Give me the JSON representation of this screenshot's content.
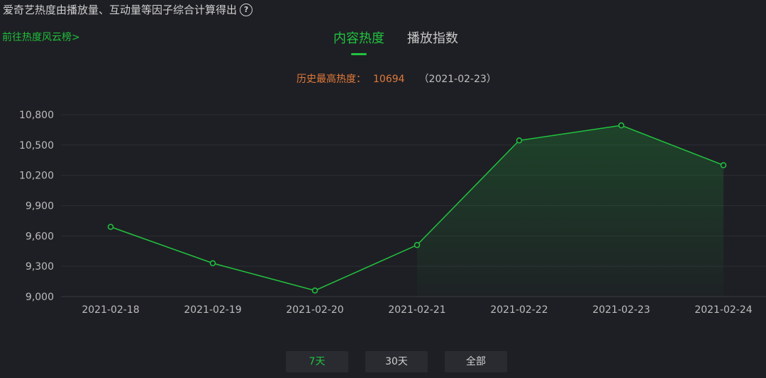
{
  "header": {
    "description": "爱奇艺热度由播放量、互动量等因子综合计算得出",
    "help_icon": "question-circle-icon"
  },
  "rank_link": "前往热度风云榜>",
  "tabs": [
    {
      "label": "内容热度",
      "active": true
    },
    {
      "label": "播放指数",
      "active": false
    }
  ],
  "peak": {
    "label": "历史最高热度：",
    "value": "10694",
    "date": "（2021-02-23）"
  },
  "range_buttons": [
    {
      "label": "7天",
      "active": true
    },
    {
      "label": "30天",
      "active": false
    },
    {
      "label": "全部",
      "active": false
    }
  ],
  "colors": {
    "accent": "#21c33f",
    "peak": "#e07a3a",
    "background": "#1e1f24"
  },
  "chart_data": {
    "type": "area",
    "x": [
      "2021-02-18",
      "2021-02-19",
      "2021-02-20",
      "2021-02-21",
      "2021-02-22",
      "2021-02-23",
      "2021-02-24"
    ],
    "series": [
      {
        "values": [
          9690,
          9330,
          9060,
          9510,
          10545,
          10694,
          10300
        ]
      }
    ],
    "y_ticks": [
      "9,000",
      "9,300",
      "9,600",
      "9,900",
      "10,200",
      "10,500",
      "10,800"
    ],
    "ylim": [
      9000,
      10800
    ],
    "grid": true,
    "legend": "none"
  }
}
